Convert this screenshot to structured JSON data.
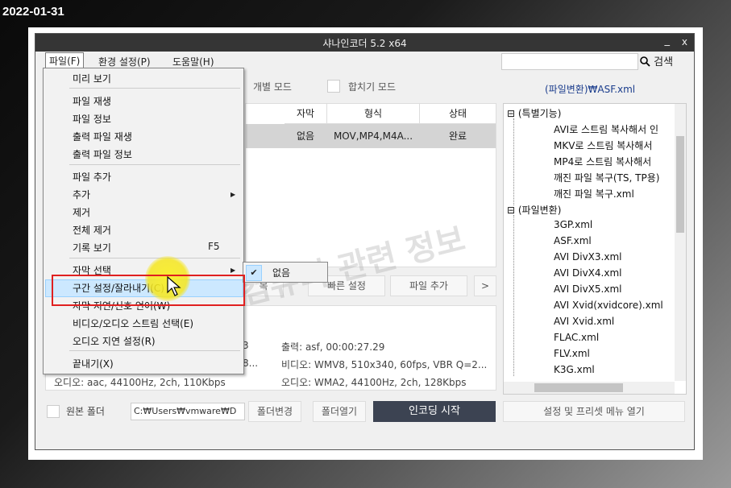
{
  "date_stamp": "2022-01-31",
  "window": {
    "title": "샤나인코더  5.2 x64",
    "minimize": "_",
    "close": "x"
  },
  "menubar": {
    "file": "파일(F)",
    "settings": "환경 설정(P)",
    "help": "도움말(H)"
  },
  "search": {
    "label": "검색",
    "value": ""
  },
  "toolbar": {
    "individual_mode": "개별 모드",
    "merge_mode": "합치기 모드",
    "preset_name": "(파일변환)₩ASF.xml"
  },
  "table": {
    "headers": [
      "자막",
      "형식",
      "상태"
    ],
    "rows": [
      {
        "subtitle": "없음",
        "format": "MOV,MP4,M4A...",
        "status": "완료"
      }
    ]
  },
  "buttons": {
    "partial": "목",
    "quick_settings": "빠른 설정",
    "add_file": "파일 추가",
    "more": ">"
  },
  "info": {
    "output": "출력: asf, 00:00:27.29",
    "video_out": "비디오: WMV8, 510x340, 60fps, VBR Q=2...",
    "audio_out": "오디오: WMA2, 44100Hz, 2ch, 128Kbps",
    "audio_in": "오디오: aac, 44100Hz, 2ch, 110Kbps",
    "in_frag1": "3",
    "in_frag2": "8..."
  },
  "tree": {
    "group1": "(특별기능)",
    "group1_items": [
      "AVI로 스트림 복사해서 인",
      "MKV로 스트림 복사해서",
      "MP4로 스트림 복사해서",
      "깨진 파일 복구(TS, TP용)",
      "깨진 파일 복구.xml"
    ],
    "group2": "(파일변환)",
    "group2_items": [
      "3GP.xml",
      "ASF.xml",
      "AVI DivX3.xml",
      "AVI DivX4.xml",
      "AVI DivX5.xml",
      "AVI Xvid(xvidcore).xml",
      "AVI Xvid.xml",
      "FLAC.xml",
      "FLV.xml",
      "K3G.xml"
    ]
  },
  "bottom": {
    "source_folder": "원본 폴더",
    "path": "C:₩Users₩vmware₩D",
    "change_folder": "폴더변경",
    "open_folder": "폴더열기",
    "start_encoding": "인코딩 시작",
    "open_presets": "설정 및 프리셋 메뉴 열기"
  },
  "file_menu": {
    "preview": "미리 보기",
    "play_file": "파일 재생",
    "file_info": "파일 정보",
    "play_output": "출력 파일 재생",
    "output_info": "출력 파일 정보",
    "add_file": "파일 추가",
    "add": "추가",
    "remove": "제거",
    "remove_all": "전체 제거",
    "history": "기록 보기",
    "history_key": "F5",
    "subtitle_select": "자막 선택",
    "section_settings": "구간 설정/잘라내기(C)",
    "subtitle_delay": "자막 지연/신호 언어(W)",
    "stream_select": "비디오/오디오 스트림 선택(E)",
    "audio_delay": "오디오 지연 설정(R)",
    "exit": "끝내기(X)"
  },
  "submenu": {
    "none": "없음"
  },
  "watermark": "컴퓨터 관련 정보"
}
